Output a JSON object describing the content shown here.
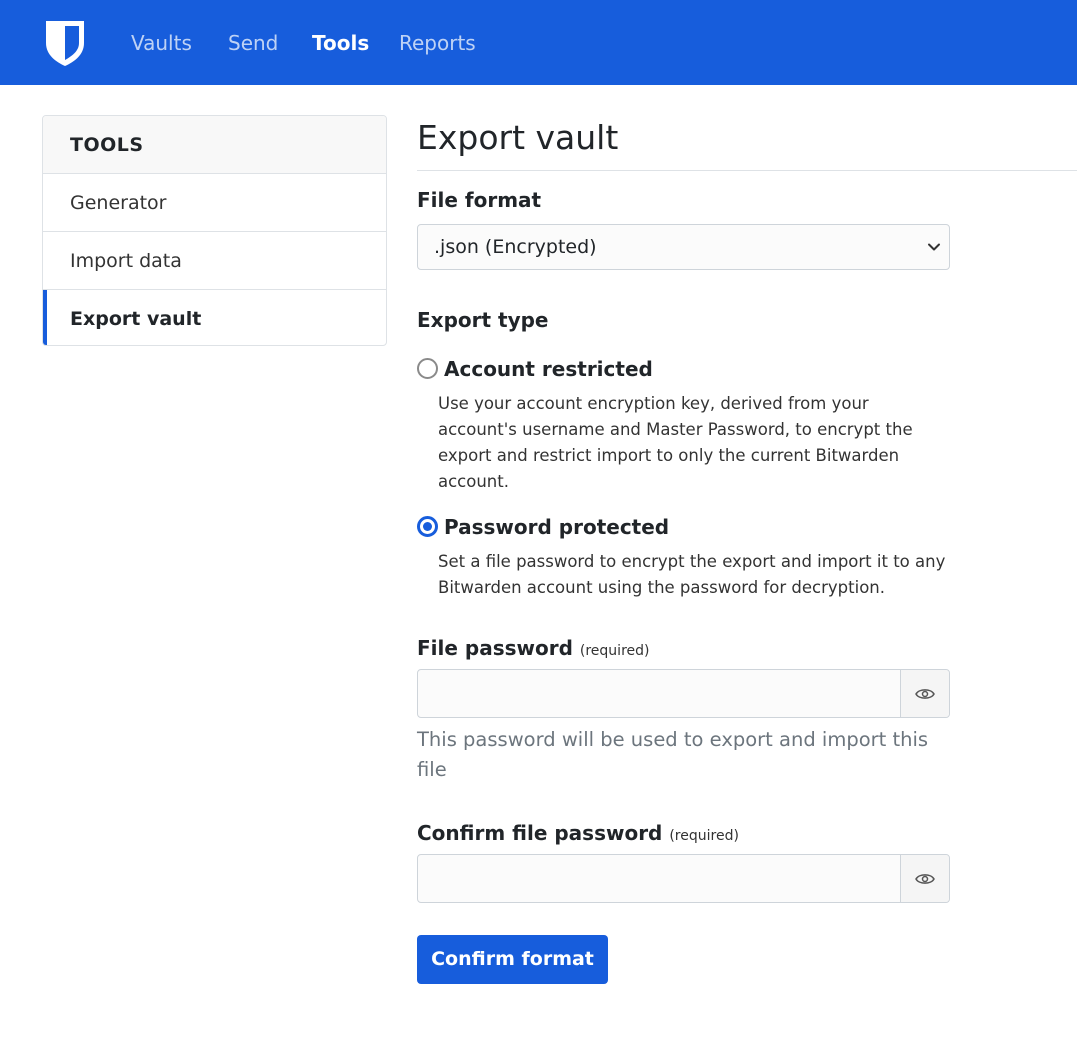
{
  "nav": {
    "links": [
      "Vaults",
      "Send",
      "Tools",
      "Reports"
    ],
    "active": "Tools"
  },
  "sidebar": {
    "header": "TOOLS",
    "items": [
      {
        "label": "Generator"
      },
      {
        "label": "Import data"
      },
      {
        "label": "Export vault",
        "active": true
      }
    ]
  },
  "main": {
    "title": "Export vault",
    "file_format": {
      "label": "File format",
      "selected": ".json (Encrypted)"
    },
    "export_type": {
      "label": "Export type",
      "options": [
        {
          "label": "Account restricted",
          "help": "Use your account encryption key, derived from your account's username and Master Password, to encrypt the export and restrict import to only the current Bitwarden account.",
          "checked": false
        },
        {
          "label": "Password protected",
          "help": "Set a file password to encrypt the export and import it to any Bitwarden account using the password for decryption.",
          "checked": true
        }
      ]
    },
    "file_password": {
      "label": "File password",
      "required": "(required)",
      "value": "",
      "hint": "This password will be used to export and import this file"
    },
    "confirm_password": {
      "label": "Confirm file password",
      "required": "(required)",
      "value": ""
    },
    "submit_label": "Confirm format"
  },
  "colors": {
    "brand": "#175ddc",
    "border": "#ced4da",
    "muted": "#6c757d"
  },
  "icons": {
    "logo": "bitwarden-shield-icon",
    "select_caret": "chevron-down-icon",
    "password_toggle": "eye-icon"
  }
}
